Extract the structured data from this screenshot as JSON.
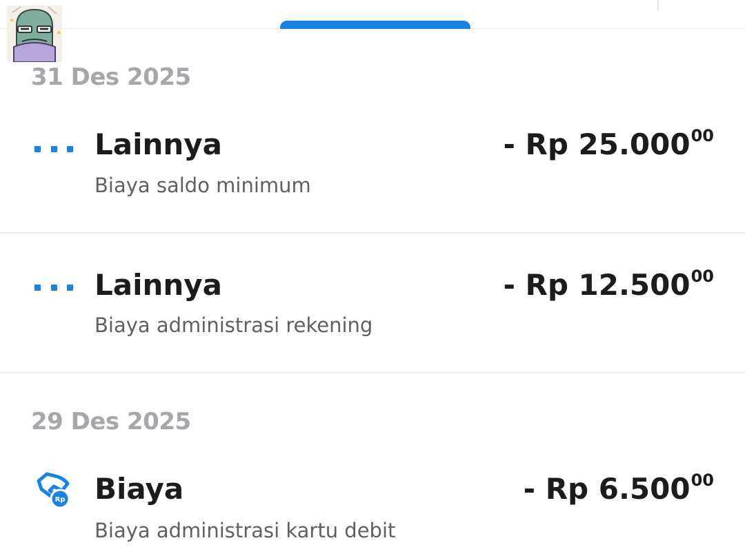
{
  "colors": {
    "accent": "#1a82e2",
    "date_text": "#a6a6ab",
    "primary_text": "#1c1c1e",
    "secondary_text": "#5f5f64"
  },
  "header": {
    "avatar_icon": "sticker-avatar-icon"
  },
  "groups": [
    {
      "date": "31 Des 2025",
      "transactions": [
        {
          "icon": "more-dots-icon",
          "title": "Lainnya",
          "description": "Biaya saldo minimum",
          "amount": "- Rp 25.000",
          "cents": "00"
        },
        {
          "icon": "more-dots-icon",
          "title": "Lainnya",
          "description": "Biaya administrasi rekening",
          "amount": "- Rp 12.500",
          "cents": "00"
        }
      ]
    },
    {
      "date": "29 Des 2025",
      "transactions": [
        {
          "icon": "fee-card-icon",
          "title": "Biaya",
          "description": "Biaya administrasi kartu debit",
          "amount": "- Rp 6.500",
          "cents": "00"
        }
      ]
    }
  ]
}
